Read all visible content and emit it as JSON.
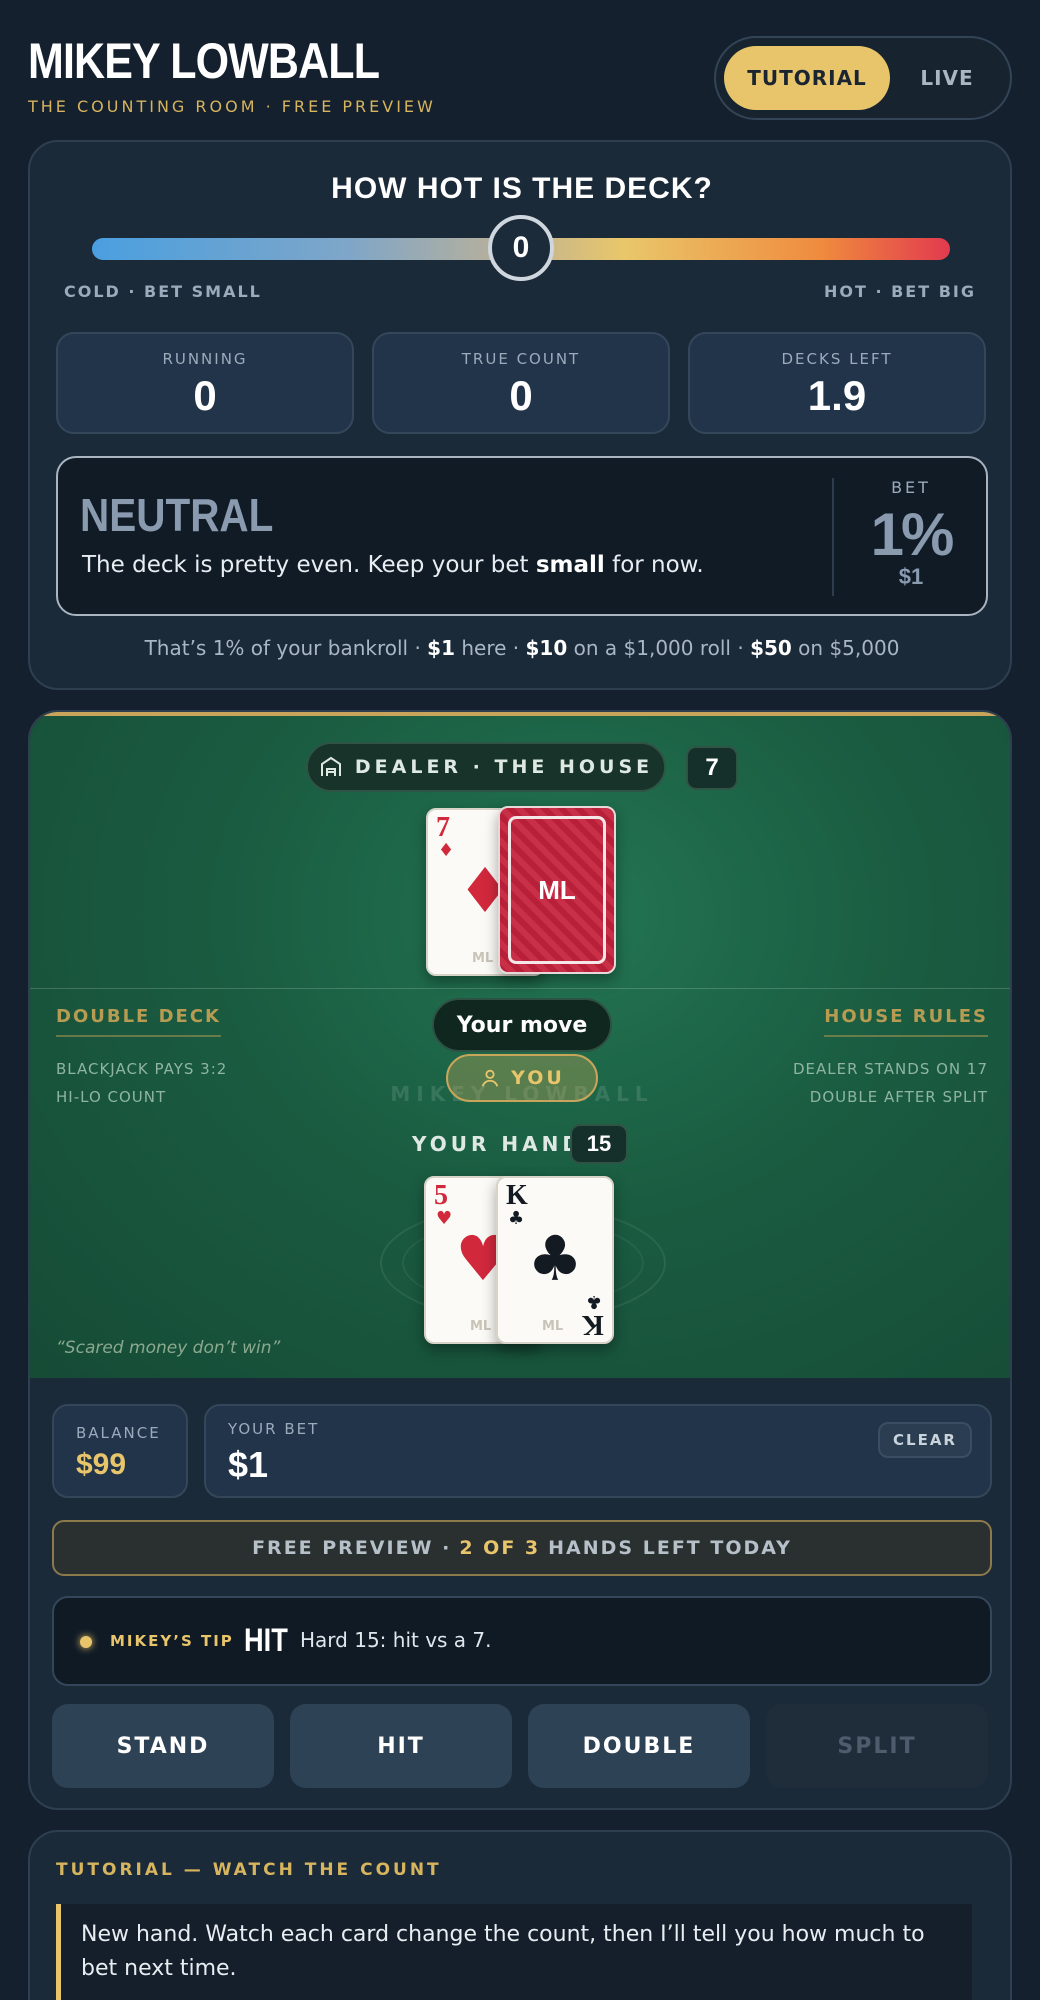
{
  "header": {
    "title": "MIKEY LOWBALL",
    "subtitle": "THE COUNTING ROOM · FREE PREVIEW",
    "modes": [
      {
        "label": "TUTORIAL",
        "active": true
      },
      {
        "label": "LIVE",
        "active": false
      }
    ]
  },
  "heat": {
    "title": "HOW HOT IS THE DECK?",
    "slider_value": "0",
    "left_label": "COLD · BET SMALL",
    "right_label": "HOT · BET BIG",
    "colors": {
      "cold": "#4a9fe0",
      "neutral": "#e9c76a",
      "hot": "#e23a4e"
    }
  },
  "stats": [
    {
      "label": "RUNNING",
      "value": "0"
    },
    {
      "label": "TRUE COUNT",
      "value": "0"
    },
    {
      "label": "DECKS LEFT",
      "value": "1.9"
    }
  ],
  "verdict": {
    "title": "NEUTRAL",
    "text_before": "The deck is pretty even. Keep your bet ",
    "text_bold": "small",
    "text_after": " for now.",
    "bet_label": "BET",
    "bet_pct": "1%",
    "bet_amount": "$1"
  },
  "bankroll": {
    "prefix": "That’s 1% of your bankroll · ",
    "here_amount": "$1",
    "here_text": " here · ",
    "k1_amount": "$10",
    "k1_text": " on a $1,000 roll · ",
    "k5_amount": "$50",
    "k5_text": " on $5,000"
  },
  "table": {
    "dealer_label": "DEALER · THE HOUSE",
    "dealer_total": "7",
    "dealer_cards": [
      {
        "rank": "7",
        "suit": "♦",
        "color": "red",
        "face_up": true
      },
      {
        "back_text": "ML",
        "face_up": false
      }
    ],
    "left_head": "DOUBLE DECK",
    "left_lines": [
      "BLACKJACK PAYS 3:2",
      "HI-LO COUNT"
    ],
    "right_head": "HOUSE RULES",
    "right_lines": [
      "DEALER STANDS ON 17",
      "DOUBLE AFTER SPLIT"
    ],
    "move_label": "Your move",
    "you_label": "YOU",
    "watermark": "MIKEY LOWBALL",
    "hand_label": "YOUR HAND",
    "hand_total": "15",
    "player_cards": [
      {
        "rank": "5",
        "suit": "♥",
        "color": "red"
      },
      {
        "rank": "K",
        "suit": "♣",
        "color": "black"
      }
    ],
    "card_mark": "ML",
    "quote": "“Scared money don’t win”"
  },
  "controls": {
    "balance_label": "BALANCE",
    "balance_value": "$99",
    "bet_label": "YOUR BET",
    "bet_value": "$1",
    "clear_label": "CLEAR",
    "preview_prefix": "FREE PREVIEW ·",
    "preview_count": "2 OF 3",
    "preview_suffix": "HANDS LEFT TODAY",
    "tip_label": "MIKEY’S TIP",
    "tip_action": "HIT",
    "tip_text": "Hard 15: hit vs a 7.",
    "actions": [
      {
        "label": "STAND",
        "enabled": true
      },
      {
        "label": "HIT",
        "enabled": true
      },
      {
        "label": "DOUBLE",
        "enabled": true
      },
      {
        "label": "SPLIT",
        "enabled": false
      }
    ]
  },
  "tutorial": {
    "heading": "TUTORIAL — WATCH THE COUNT",
    "body": "New hand. Watch each card change the count, then I’ll tell you how much to bet next time."
  }
}
